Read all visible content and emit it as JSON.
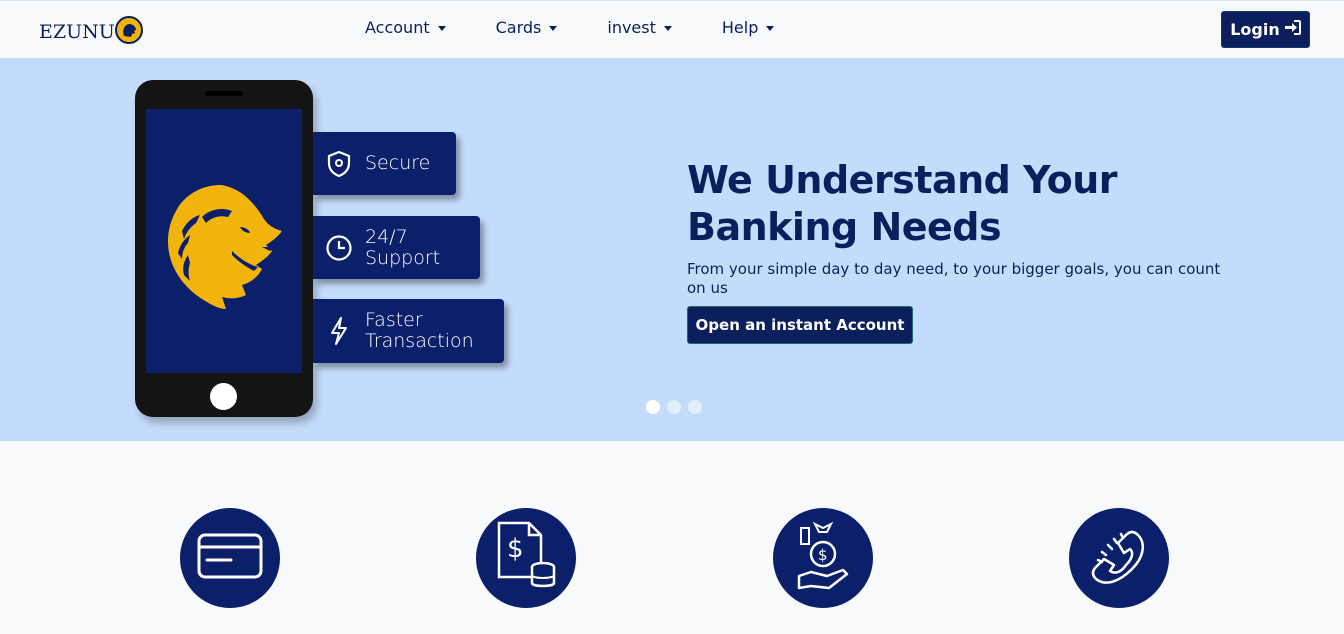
{
  "brand": {
    "name": "EZUNU",
    "logo_icon": "lion-logo-icon"
  },
  "nav": {
    "items": [
      {
        "label": "Account"
      },
      {
        "label": "Cards"
      },
      {
        "label": "invest"
      },
      {
        "label": "Help"
      }
    ],
    "login_label": "Login"
  },
  "hero": {
    "features": [
      {
        "icon": "shield-icon",
        "line1": "Secure",
        "line2": ""
      },
      {
        "icon": "clock-icon",
        "line1": "24/7",
        "line2": "Support"
      },
      {
        "icon": "lightning-icon",
        "line1": "Faster",
        "line2": "Transaction"
      }
    ],
    "title_line1": "We Understand Your",
    "title_line2": "Banking Needs",
    "subtitle": "From your simple day to day need, to your bigger goals, you can count on us",
    "cta_label": "Open an instant Account",
    "slides": 3,
    "active_slide": 1
  },
  "services": [
    {
      "icon": "credit-card-icon"
    },
    {
      "icon": "invoice-coins-icon"
    },
    {
      "icon": "money-bag-hand-icon"
    },
    {
      "icon": "telephone-icon"
    }
  ],
  "colors": {
    "primary": "#0b1f5c",
    "hero_bg": "#c4dcfb",
    "lion_gold": "#f1b40a",
    "page_bg": "#f8f9fa"
  }
}
